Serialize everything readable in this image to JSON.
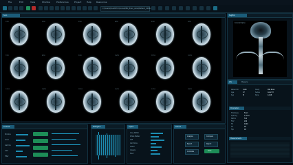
{
  "menubar": {
    "items": [
      "File",
      "Edit",
      "View",
      "Window",
      "Preferences",
      "Project",
      "Help",
      "Resources"
    ]
  },
  "toolbar": {
    "path": "C:\\Users\\HealthPro\\Scans\\MRI_Brain_Axial\\Patient_0184.dcm"
  },
  "scan_viewer": {
    "tab": "Scan",
    "slices": [
      "1/18",
      "2/18",
      "3/18",
      "4/18",
      "5/18",
      "6/18",
      "7/18",
      "8/18",
      "9/18",
      "10/18",
      "11/18",
      "12/18",
      "13/18",
      "14/18",
      "15/18",
      "16/18",
      "17/18",
      "18/18"
    ]
  },
  "side_panel": {
    "tab": "Sagittal",
    "label": "Cervical Spine"
  },
  "info_panel": {
    "tab1": "Info",
    "tab2": "Measure",
    "fields": [
      "Patient ID",
      "Age",
      "Sex",
      "Study",
      "Series",
      "Slice"
    ],
    "values": [
      "0184",
      "47",
      "M",
      "MRI Brain",
      "Axial T2",
      "12/18"
    ],
    "list_header": "Parameters",
    "list_items": [
      "Thickness",
      "Spacing",
      "Matrix",
      "FOV",
      "TR",
      "TE",
      "Flip"
    ],
    "list_values": [
      "5mm",
      "1.2mm",
      "512",
      "240",
      "4200",
      "95",
      "90"
    ],
    "table_header": "Measurements"
  },
  "bottom_panels": {
    "panel1_title": "Contrast",
    "panel1_rows": [
      "Window",
      "Level",
      "Gamma",
      "Gain",
      "Filter"
    ],
    "panel2_title": "Histogram",
    "panel3_title": "Layers",
    "panel3_rows": [
      "Grey Matter",
      "White Matter",
      "CSF",
      "Ventricles",
      "Lesion",
      "Vessels",
      "Skull"
    ],
    "panel4_title": "Actions",
    "panel4_buttons": [
      "Analyze",
      "Compare",
      "Export",
      "Report",
      "Annotate",
      "Save"
    ]
  }
}
